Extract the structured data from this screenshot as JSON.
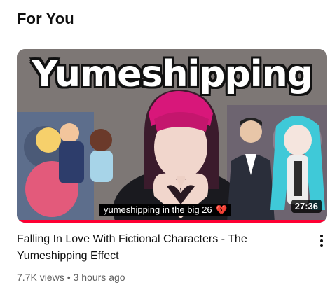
{
  "section": {
    "title": "For You"
  },
  "video": {
    "thumbnail_text": "Yumeshipping",
    "caption": "yumeshipping in the big 26",
    "caption_emoji": "💔",
    "duration": "27:36",
    "watched_fraction": 1.0,
    "title": "Falling In Love With Fictional Characters - The Yumeshipping Effect",
    "views": "7.7K views",
    "separator": "•",
    "age": "3 hours ago"
  },
  "colors": {
    "progress": "#ff0033",
    "text_secondary": "#606060"
  },
  "icons": {
    "more": "more-vert-icon",
    "heart": "broken-heart-icon"
  }
}
